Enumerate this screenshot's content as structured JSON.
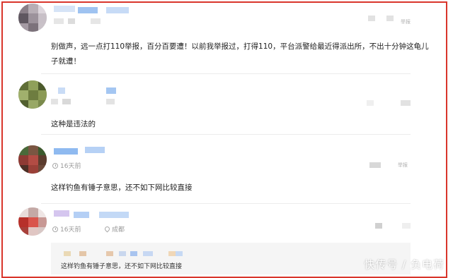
{
  "comments": [
    {
      "text": "别做声，远一点打110举报，百分百要遭！以前我举报过，打得110，平台派警给最近得派出所，不出十分钟这龟儿子就遭！",
      "action_label": "举报"
    },
    {
      "text": "这种是违法的"
    },
    {
      "time": "16天前",
      "text": "这样钓鱼有锤子意思，还不如下网比较直接",
      "action_label": "举报"
    },
    {
      "time": "16天前",
      "location": "成都",
      "quote_text": "这样钓鱼有锤子意思，还不如下网比较直接"
    }
  ],
  "watermark": "快传号 / 负电荷"
}
